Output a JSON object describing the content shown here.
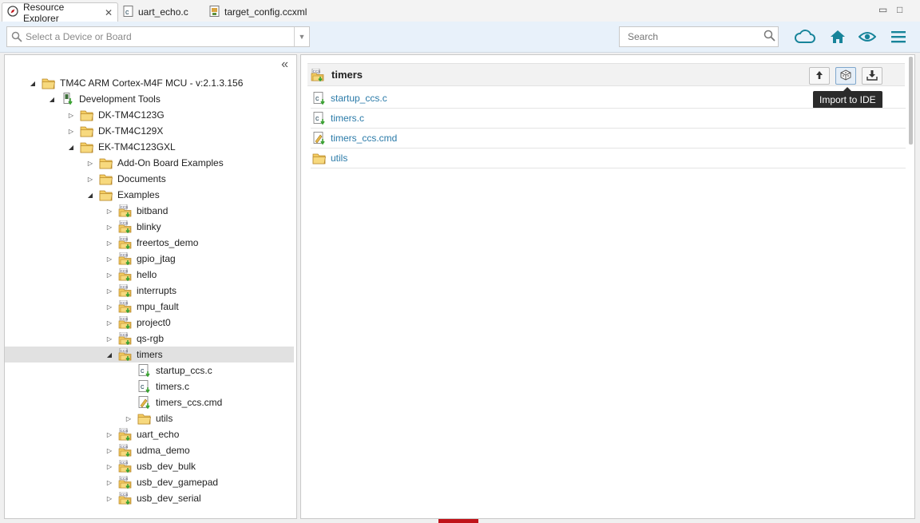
{
  "tabs": [
    {
      "label": "Resource Explorer",
      "active": true,
      "closable": true,
      "icon": "compass-icon"
    },
    {
      "label": "uart_echo.c",
      "active": false,
      "closable": false,
      "icon": "c-file-icon"
    },
    {
      "label": "target_config.ccxml",
      "active": false,
      "closable": false,
      "icon": "config-file-icon"
    }
  ],
  "window_controls": {
    "minimize": "▭",
    "maximize": "□"
  },
  "toolbar": {
    "device_placeholder": "Select a Device or Board",
    "search_placeholder": "Search",
    "icons": [
      "cloud-icon",
      "home-icon",
      "eye-icon",
      "hamburger-menu-icon"
    ],
    "accent": "#17849a"
  },
  "left_panel": {
    "collapse_label": "«",
    "tree": [
      {
        "label": "TM4C ARM Cortex-M4F MCU - v:2.1.3.156",
        "depth": 1,
        "state": "open",
        "icon": "folder"
      },
      {
        "label": "Development Tools",
        "depth": 2,
        "state": "open",
        "icon": "tools"
      },
      {
        "label": "DK-TM4C123G",
        "depth": 3,
        "state": "closed",
        "icon": "folder"
      },
      {
        "label": "DK-TM4C129X",
        "depth": 3,
        "state": "closed",
        "icon": "folder"
      },
      {
        "label": "EK-TM4C123GXL",
        "depth": 3,
        "state": "open",
        "icon": "folder"
      },
      {
        "label": "Add-On Board Examples",
        "depth": 4,
        "state": "closed",
        "icon": "folder"
      },
      {
        "label": "Documents",
        "depth": 4,
        "state": "closed",
        "icon": "folder"
      },
      {
        "label": "Examples",
        "depth": 4,
        "state": "open",
        "icon": "folder"
      },
      {
        "label": "bitband",
        "depth": 5,
        "state": "closed",
        "icon": "ccs"
      },
      {
        "label": "blinky",
        "depth": 5,
        "state": "closed",
        "icon": "ccs"
      },
      {
        "label": "freertos_demo",
        "depth": 5,
        "state": "closed",
        "icon": "ccs"
      },
      {
        "label": "gpio_jtag",
        "depth": 5,
        "state": "closed",
        "icon": "ccs"
      },
      {
        "label": "hello",
        "depth": 5,
        "state": "closed",
        "icon": "ccs"
      },
      {
        "label": "interrupts",
        "depth": 5,
        "state": "closed",
        "icon": "ccs"
      },
      {
        "label": "mpu_fault",
        "depth": 5,
        "state": "closed",
        "icon": "ccs"
      },
      {
        "label": "project0",
        "depth": 5,
        "state": "closed",
        "icon": "ccs"
      },
      {
        "label": "qs-rgb",
        "depth": 5,
        "state": "closed",
        "icon": "ccs"
      },
      {
        "label": "timers",
        "depth": 5,
        "state": "open",
        "icon": "ccs",
        "selected": true
      },
      {
        "label": "startup_ccs.c",
        "depth": 6,
        "state": "leaf",
        "icon": "cfile"
      },
      {
        "label": "timers.c",
        "depth": 6,
        "state": "leaf",
        "icon": "cfile"
      },
      {
        "label": "timers_ccs.cmd",
        "depth": 6,
        "state": "leaf",
        "icon": "cmd"
      },
      {
        "label": "utils",
        "depth": 6,
        "state": "closed",
        "icon": "folder"
      },
      {
        "label": "uart_echo",
        "depth": 5,
        "state": "closed",
        "icon": "ccs"
      },
      {
        "label": "udma_demo",
        "depth": 5,
        "state": "closed",
        "icon": "ccs"
      },
      {
        "label": "usb_dev_bulk",
        "depth": 5,
        "state": "closed",
        "icon": "ccs"
      },
      {
        "label": "usb_dev_gamepad",
        "depth": 5,
        "state": "closed",
        "icon": "ccs"
      },
      {
        "label": "usb_dev_serial",
        "depth": 5,
        "state": "closed",
        "icon": "ccs"
      }
    ]
  },
  "right_panel": {
    "title": "timers",
    "title_icon": "ccs",
    "actions": [
      {
        "name": "up-arrow-icon",
        "active": false
      },
      {
        "name": "import-to-ide-icon",
        "active": true
      },
      {
        "name": "download-icon",
        "active": false
      }
    ],
    "tooltip": "Import to IDE",
    "files": [
      {
        "label": "startup_ccs.c",
        "icon": "cfile"
      },
      {
        "label": "timers.c",
        "icon": "cfile"
      },
      {
        "label": "timers_ccs.cmd",
        "icon": "cmd"
      },
      {
        "label": "utils",
        "icon": "folder"
      }
    ]
  },
  "colors": {
    "link": "#2a7aa8",
    "folder": "#e8b84a",
    "green_arrow": "#3aa132",
    "status_red": "#c0141a"
  }
}
